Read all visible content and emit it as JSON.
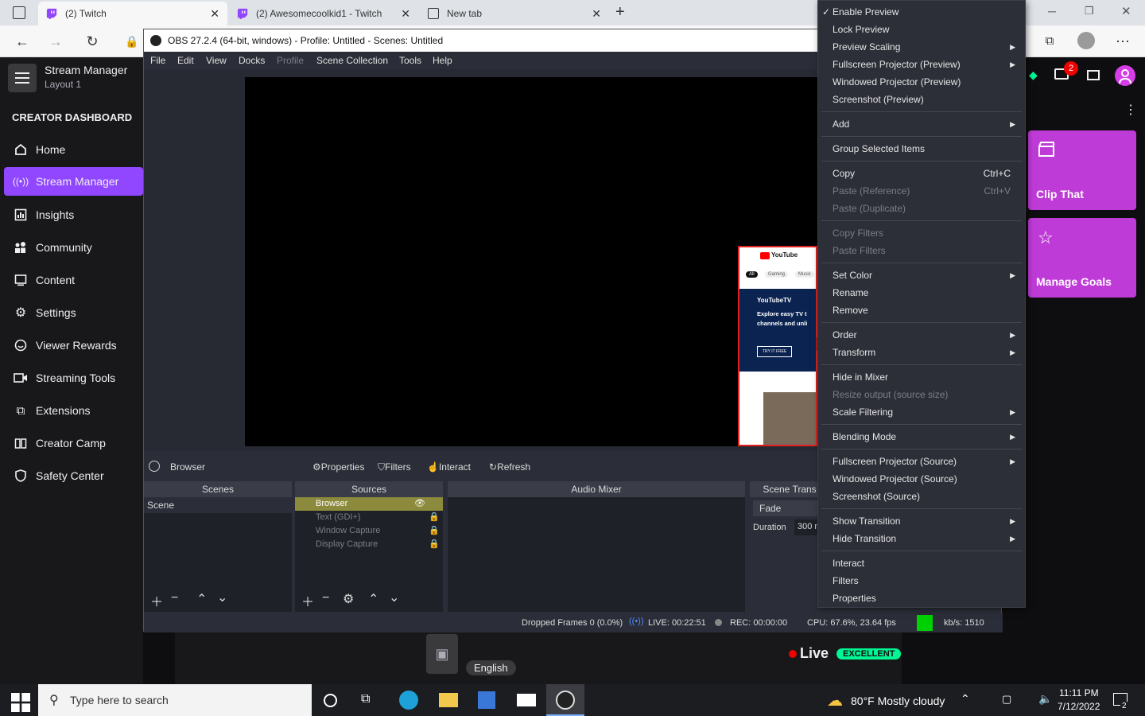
{
  "browser": {
    "tabs": [
      {
        "title": "(2) Twitch",
        "active": true
      },
      {
        "title": "(2) Awesomecoolkid1 - Twitch",
        "active": false
      },
      {
        "title": "New tab",
        "active": false
      }
    ]
  },
  "twitch": {
    "header": {
      "title": "Stream Manager",
      "subtitle": "Layout 1"
    },
    "section": "CREATOR DASHBOARD",
    "nav": [
      {
        "label": "Home",
        "icon": "home-icon"
      },
      {
        "label": "Stream Manager",
        "icon": "broadcast-icon",
        "active": true
      },
      {
        "label": "Insights",
        "icon": "chart-icon"
      },
      {
        "label": "Community",
        "icon": "people-icon"
      },
      {
        "label": "Content",
        "icon": "content-icon"
      },
      {
        "label": "Settings",
        "icon": "gear-icon"
      },
      {
        "label": "Viewer Rewards",
        "icon": "reward-icon"
      },
      {
        "label": "Streaming Tools",
        "icon": "camera-icon"
      },
      {
        "label": "Extensions",
        "icon": "puzzle-icon"
      },
      {
        "label": "Creator Camp",
        "icon": "book-icon"
      },
      {
        "label": "Safety Center",
        "icon": "shield-icon"
      }
    ],
    "notification_count": "2",
    "quick_actions": [
      {
        "label": "Clip That",
        "icon": "clapper-icon"
      },
      {
        "label": "Manage Goals",
        "icon": "star-icon"
      }
    ],
    "bottom": {
      "language": "English",
      "live_label": "Live",
      "quality": "EXCELLENT"
    }
  },
  "obs": {
    "title": "OBS 27.2.4 (64-bit, windows) - Profile: Untitled - Scenes: Untitled",
    "menu": [
      "File",
      "Edit",
      "View",
      "Docks",
      "Profile",
      "Scene Collection",
      "Tools",
      "Help"
    ],
    "source_toolbar": {
      "source": "Browser",
      "properties": "Properties",
      "filters": "Filters",
      "interact": "Interact",
      "refresh": "Refresh"
    },
    "docks": {
      "scenes": "Scenes",
      "sources": "Sources",
      "audio_mixer": "Audio Mixer",
      "transitions": "Scene Trans"
    },
    "scenes": [
      "Scene"
    ],
    "sources": [
      "Browser",
      "Text (GDI+)",
      "Window Capture",
      "Display Capture"
    ],
    "transition": {
      "type": "Fade",
      "duration_label": "Duration",
      "duration_value": "300 m"
    },
    "status": {
      "dropped": "Dropped Frames 0 (0.0%)",
      "live": "LIVE: 00:22:51",
      "rec": "REC: 00:00:00",
      "cpu": "CPU: 67.6%, 23.64 fps",
      "kbps": "kb/s: 1510"
    },
    "preview_thumb": {
      "brand": "YouTube",
      "chips": [
        "All",
        "Gaming",
        "Music"
      ],
      "tv": "YouTubeTV",
      "headline": "Explore easy TV t channels and unli",
      "cta": "TRY IT FREE"
    }
  },
  "context_menu": {
    "groups": [
      [
        {
          "label": "Enable Preview",
          "checked": true
        },
        {
          "label": "Lock Preview"
        },
        {
          "label": "Preview Scaling",
          "submenu": true
        },
        {
          "label": "Fullscreen Projector (Preview)",
          "submenu": true
        },
        {
          "label": "Windowed Projector (Preview)"
        },
        {
          "label": "Screenshot (Preview)"
        }
      ],
      [
        {
          "label": "Add",
          "submenu": true
        }
      ],
      [
        {
          "label": "Group Selected Items"
        }
      ],
      [
        {
          "label": "Copy",
          "shortcut": "Ctrl+C"
        },
        {
          "label": "Paste (Reference)",
          "shortcut": "Ctrl+V",
          "disabled": true
        },
        {
          "label": "Paste (Duplicate)",
          "disabled": true
        }
      ],
      [
        {
          "label": "Copy Filters",
          "disabled": true
        },
        {
          "label": "Paste Filters",
          "disabled": true
        }
      ],
      [
        {
          "label": "Set Color",
          "submenu": true
        },
        {
          "label": "Rename"
        },
        {
          "label": "Remove"
        }
      ],
      [
        {
          "label": "Order",
          "submenu": true
        },
        {
          "label": "Transform",
          "submenu": true
        }
      ],
      [
        {
          "label": "Hide in Mixer"
        },
        {
          "label": "Resize output (source size)",
          "disabled": true
        },
        {
          "label": "Scale Filtering",
          "submenu": true
        }
      ],
      [
        {
          "label": "Blending Mode",
          "submenu": true
        }
      ],
      [
        {
          "label": "Fullscreen Projector (Source)",
          "submenu": true
        },
        {
          "label": "Windowed Projector (Source)"
        },
        {
          "label": "Screenshot (Source)"
        }
      ],
      [
        {
          "label": "Show Transition",
          "submenu": true
        },
        {
          "label": "Hide Transition",
          "submenu": true
        }
      ],
      [
        {
          "label": "Interact"
        },
        {
          "label": "Filters"
        },
        {
          "label": "Properties"
        }
      ]
    ]
  },
  "taskbar": {
    "search_placeholder": "Type here to search",
    "weather": "80°F  Mostly cloudy",
    "time": "11:11 PM",
    "date": "7/12/2022",
    "notifications": "2"
  },
  "colors": {
    "twitch_purple": "#9147ff",
    "quick_action": "#bf3bd8",
    "live_red": "#eb0400",
    "excellent_green": "#00f593"
  }
}
